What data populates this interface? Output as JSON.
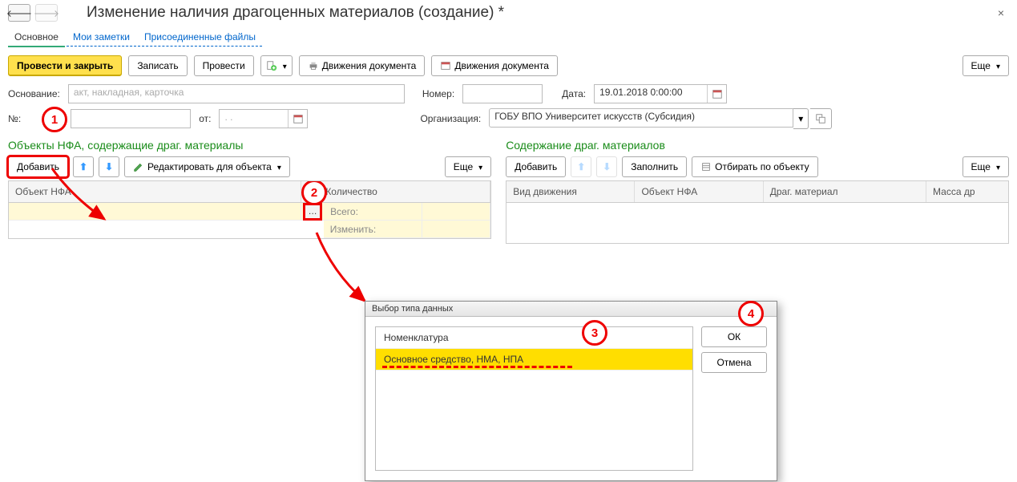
{
  "title": "Изменение наличия драгоценных материалов (создание) *",
  "tabs": {
    "main": "Основное",
    "notes": "Мои заметки",
    "files": "Присоединенные файлы"
  },
  "toolbar": {
    "post_close": "Провести и закрыть",
    "save": "Записать",
    "post": "Провести",
    "movements1": "Движения документа",
    "movements2": "Движения документа",
    "more": "Еще"
  },
  "form": {
    "basis_label": "Основание:",
    "basis_ph": "акт, накладная, карточка",
    "number_label": "Номер:",
    "date_label": "Дата:",
    "date_value": "19.01.2018  0:00:00",
    "ext_no_label": "№:",
    "from_label": "от:",
    "from_ph": ". .",
    "org_label": "Организация:",
    "org_value": "ГОБУ ВПО Университет искусств (Субсидия)"
  },
  "left": {
    "title": "Объекты НФА, содержащие драг. материалы",
    "add": "Добавить",
    "edit_obj": "Редактировать для объекта",
    "more": "Еще",
    "col_obj": "Объект НФА",
    "col_qty": "Количество",
    "inner_total": "Всего:",
    "inner_change": "Изменить:"
  },
  "right": {
    "title": "Содержание драг. материалов",
    "add": "Добавить",
    "fill": "Заполнить",
    "select_by_obj": "Отбирать по объекту",
    "more": "Еще",
    "col_move": "Вид движения",
    "col_obj": "Объект НФА",
    "col_mat": "Драг. материал",
    "col_mass": "Масса др"
  },
  "dialog": {
    "title": "Выбор типа данных",
    "item1": "Номенклатура",
    "item2": "Основное средство, НМА, НПА",
    "ok": "ОК",
    "cancel": "Отмена"
  },
  "markers": {
    "m1": "1",
    "m2": "2",
    "m3": "3",
    "m4": "4"
  }
}
